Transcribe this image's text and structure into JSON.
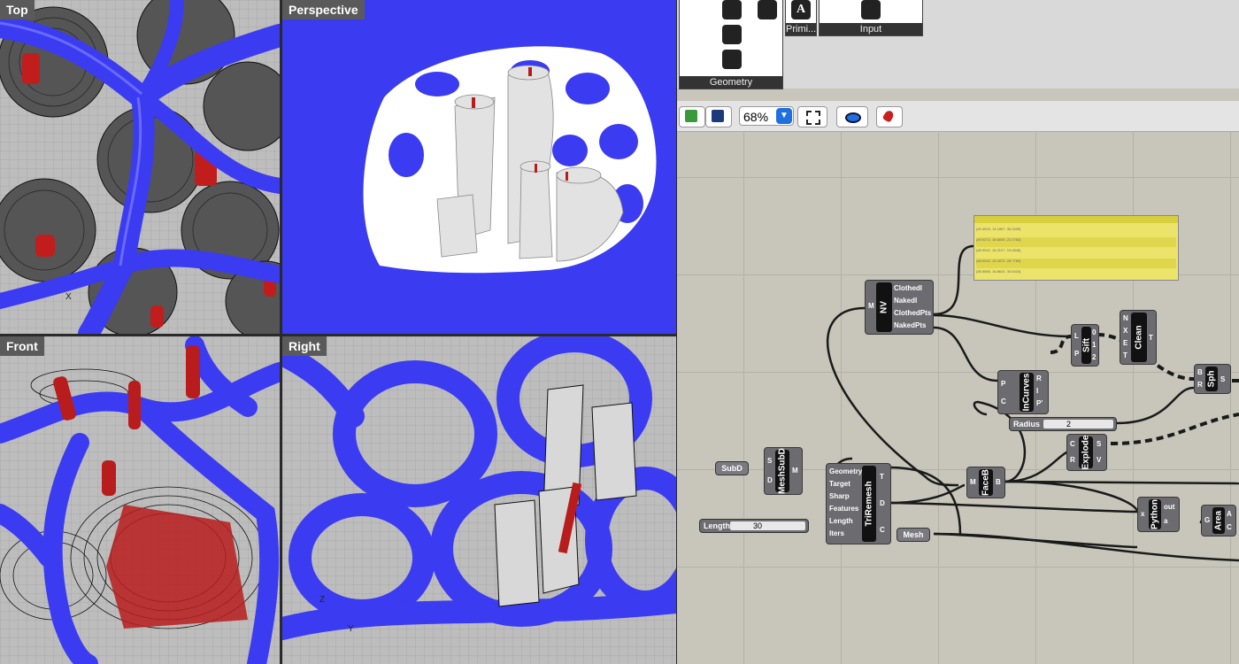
{
  "viewports": {
    "top": {
      "label": "Top",
      "axis_x": "X"
    },
    "perspective": {
      "label": "Perspective"
    },
    "front": {
      "label": "Front"
    },
    "right": {
      "label": "Right",
      "axis_z": "Z",
      "axis_y": "Y"
    }
  },
  "ribbon": {
    "geometry_group": "Geometry",
    "primitive_group": "Primi...",
    "input_group": "Input",
    "primitive_icon": "A"
  },
  "toolbar": {
    "zoom": "68%"
  },
  "canvas": {
    "panel_rows": [
      "{49.4003, 15.1897, 35.2639}",
      "{49.0272, 18.6839, 22.0782}",
      "{48.0042, 16.2127, 19.0846}",
      "{48.0042, 15.0072, 28.7769}",
      "{58.5586, 16.8624, 33.5424}"
    ],
    "nv": {
      "name": "NV",
      "in": [
        "M"
      ],
      "out": [
        "ClothedI",
        "NakedI",
        "ClothedPts",
        "NakedPts"
      ]
    },
    "sift": {
      "name": "Sift",
      "in": [
        "L",
        "P"
      ],
      "out": [
        "0",
        "1",
        "2"
      ]
    },
    "clean": {
      "name": "Clean",
      "in": [
        "N",
        "X",
        "E",
        "T"
      ],
      "out": [
        "T"
      ]
    },
    "incurves": {
      "name": "InCurves",
      "in": [
        "P",
        "C"
      ],
      "out": [
        "R",
        "I",
        "P'"
      ]
    },
    "sph": {
      "name": "Sph",
      "in": [
        "B",
        "R"
      ],
      "out": [
        "S"
      ]
    },
    "radius": {
      "label": "Radius",
      "value": "2"
    },
    "explode": {
      "name": "Explode",
      "in": [
        "C",
        "R"
      ],
      "out": [
        "S",
        "V"
      ]
    },
    "subd": {
      "label": "SubD"
    },
    "meshsubd": {
      "name": "MeshSubD",
      "in": [
        "S",
        "D"
      ],
      "out": [
        "M"
      ]
    },
    "triremesh": {
      "name": "TriRemesh",
      "in": [
        "Geometry",
        "Target",
        "Sharp",
        "Features",
        "Length",
        "Iters"
      ],
      "out": [
        "T",
        "D",
        "C"
      ]
    },
    "length": {
      "label": "Length",
      "value": "30"
    },
    "faceb": {
      "name": "FaceB",
      "in": [
        "M"
      ],
      "out": [
        "B"
      ]
    },
    "mesh": {
      "label": "Mesh"
    },
    "python": {
      "name": "Python",
      "in": [
        "x"
      ],
      "out": [
        "out",
        "a"
      ]
    },
    "area": {
      "name": "Area",
      "in": [
        "G"
      ],
      "out": [
        "A",
        "C"
      ]
    }
  },
  "colors": {
    "mesh_blue": "#3b3bf2",
    "pipe_red": "#b81c1c",
    "panel_yellow": "#ece46a"
  }
}
